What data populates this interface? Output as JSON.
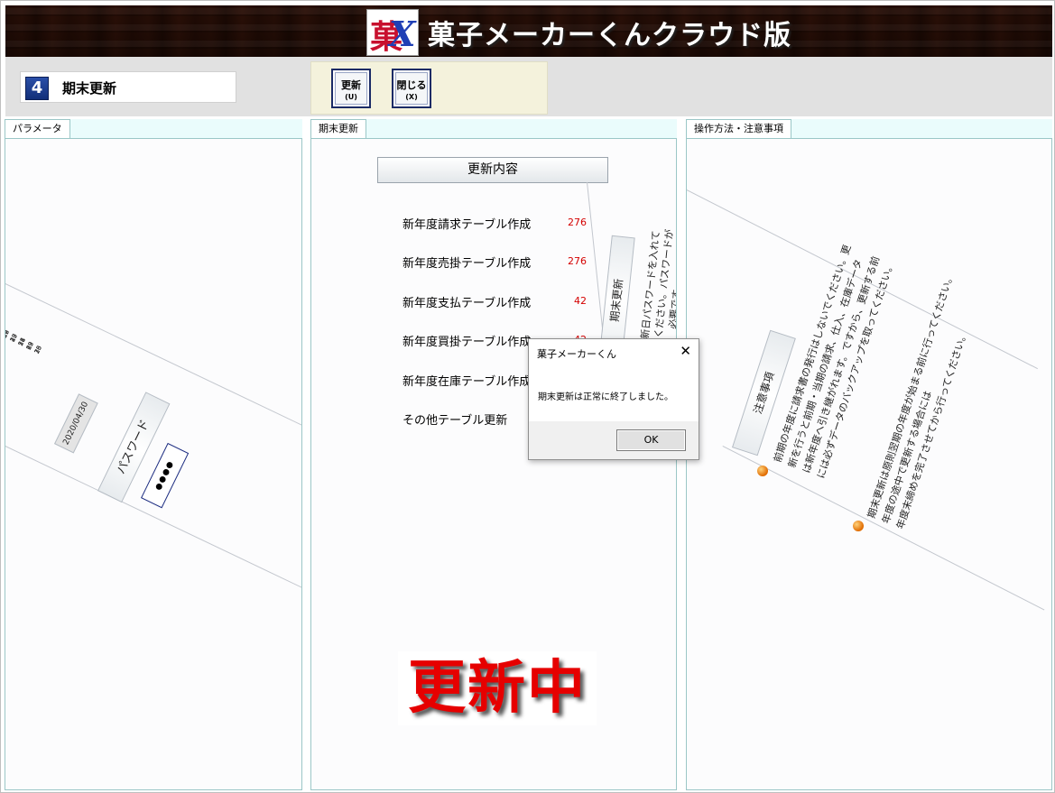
{
  "header": {
    "app_title": "菓子メーカーくんクラウド版",
    "logo_kanji": "菓",
    "logo_x": "X"
  },
  "mode": {
    "number": "4",
    "label": "期末更新"
  },
  "toolbar": {
    "update_label": "更新",
    "update_key": "(U)",
    "close_label": "閉じる",
    "close_key": "(X)"
  },
  "tabs": {
    "parameters": "パラメータ",
    "update": "期末更新",
    "notes": "操作方法・注意事項"
  },
  "parameters": {
    "date_value": "2020/04/30",
    "password_label": "パスワード",
    "password_mask": "●●●●",
    "calendar_rows": [
      "12 13 14 15 16",
      "19 20 21 22 23",
      "26 27 28 29 30",
      "3 4 5 6 7"
    ]
  },
  "update_panel": {
    "content_header": "更新内容",
    "rows": [
      {
        "label": "新年度請求テーブル作成",
        "value": "276"
      },
      {
        "label": "新年度売掛テーブル作成",
        "value": "276"
      },
      {
        "label": "新年度支払テーブル作成",
        "value": "42"
      },
      {
        "label": "新年度買掛テーブル作成",
        "value": "42"
      },
      {
        "label": "新年度在庫テーブル作成",
        "value": ""
      },
      {
        "label": "その他テーブル更新",
        "value": ""
      }
    ],
    "rotated_label": "期末更新",
    "rotated_note_1": "更新日パスワードを入れて",
    "rotated_note_2": "ください。パスワードが",
    "rotated_note_3": "必要です。",
    "status_text": "更新中"
  },
  "dialog": {
    "title": "菓子メーカーくん",
    "close_glyph": "✕",
    "message": "期末更新は正常に終了しました。",
    "ok_label": "OK"
  },
  "notes": {
    "heading": "注意事項",
    "note1_lines": [
      "前期の年度に請求書の発行はしないでください。更",
      "新を行うと前期・当期の請求、仕入、在庫データ",
      "は新年度へ引き継がれます。ですから、更新する前",
      "には必ずデータのバックアップを取ってください。"
    ],
    "note2_lines": [
      "期末更新は原則翌期の年度が始まる前に行ってください。",
      "年度の途中で更新する場合には",
      "年度末締めを完了させてから行ってください。"
    ]
  }
}
